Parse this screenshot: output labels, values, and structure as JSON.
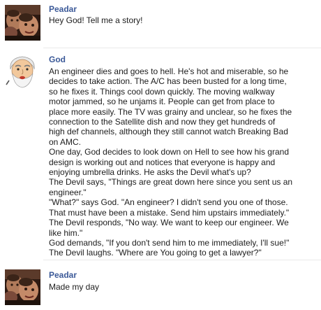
{
  "messages": [
    {
      "author": "Peadar",
      "lines": [
        "Hey God! Tell me a story!"
      ]
    },
    {
      "author": "God",
      "lines": [
        "An engineer dies and goes to hell. He's hot and miserable, so he",
        "decides to take action. The A/C has been busted for a long time,",
        "so he fixes it. Things cool down quickly. The moving walkway",
        "motor jammed, so he unjams it. People can get from place to",
        "place more easily. The TV was grainy and unclear, so he fixes the",
        "connection to the Satellite dish and now they get hundreds of",
        "high def channels, although they still cannot watch Breaking Bad",
        "on AMC.",
        "One day, God decides to look down on Hell to see how his grand",
        "design is working out and notices that everyone is happy and",
        "enjoying umbrella drinks. He asks the Devil what's up?",
        "The Devil says, \"Things are great down here since you sent us an",
        "engineer.\"",
        "\"What?\" says God. \"An engineer? I didn't send you one of those.",
        "That must have been a mistake. Send him upstairs immediately.\"",
        "The Devil responds, \"No way. We want to keep our engineer. We",
        "like him.\"",
        "God demands, \"If you don't send him to me immediately, I'll sue!\"",
        "The Devil laughs. \"Where are You going to get a lawyer?\""
      ]
    },
    {
      "author": "Peadar",
      "lines": [
        "Made my day"
      ]
    }
  ],
  "colors": {
    "author_link": "#3b5998",
    "text": "#1c1c1c",
    "divider": "#e9e9e9"
  }
}
